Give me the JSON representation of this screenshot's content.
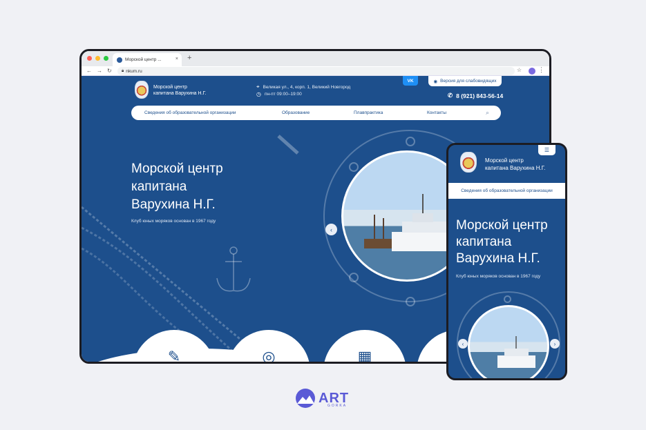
{
  "browser": {
    "tab_title": "Морской центр ...",
    "tab_close": "×",
    "tab_new": "+",
    "url": "nkum.ru",
    "dot_colors": [
      "#ff5f57",
      "#febc2e",
      "#28c840"
    ]
  },
  "site": {
    "logo_line1": "Морской центр",
    "logo_line2": "капитана Варухина Н.Г.",
    "address": "Великая ул., 4, корп. 1, Великий Новгород",
    "hours": "пн-пт 09:00–19:00",
    "vk_label": "VK",
    "low_vision_label": "Версия для слабовидящих",
    "phone": "8 (921) 843-56-14",
    "menu": [
      "Сведения об образовательной организации",
      "Образование",
      "Плавпрактика",
      "Контакты"
    ],
    "hero_title_line1": "Морской центр",
    "hero_title_line2": "капитана",
    "hero_title_line3": "Варухина Н.Г.",
    "hero_subtitle": "Клуб юных моряков основан в 1967 году",
    "accent_color": "#1d4f8c"
  },
  "mobile": {
    "logo_line1": "Морской центр",
    "logo_line2": "капитана Варухина Н.Г.",
    "menu_item": "Сведения об образовательной организации",
    "title_line1": "Морской центр",
    "title_line2": "капитана",
    "title_line3": "Варухина Н.Г.",
    "subtitle": "Клуб юных моряков основан в 1967 году"
  },
  "brand": {
    "name": "ART",
    "sub": "GORKA",
    "color": "#5a5ad6"
  }
}
